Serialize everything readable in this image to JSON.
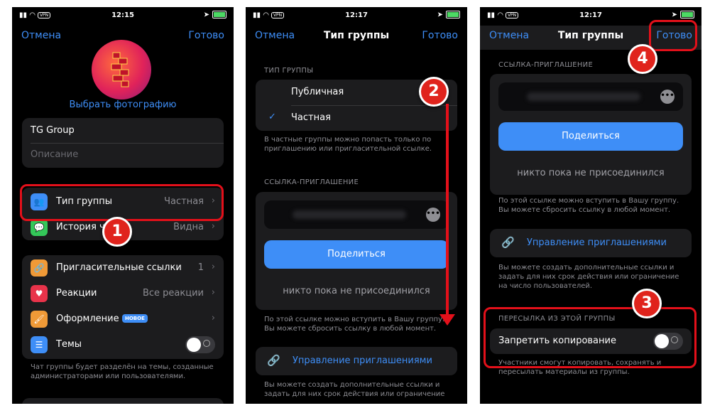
{
  "status": {
    "time1": "12:15",
    "time2": "12:17",
    "time3": "12:17",
    "vpn": "VPN"
  },
  "screen1": {
    "cancel": "Отмена",
    "done": "Готово",
    "choose_photo": "Выбрать фотографию",
    "group_name": "TG Group",
    "description_placeholder": "Описание",
    "group_type_label": "Тип группы",
    "group_type_value": "Частная",
    "history_label": "История ч",
    "history_value": "Видна",
    "invite_links_label": "Пригласительные ссылки",
    "invite_links_value": "1",
    "reactions_label": "Реакции",
    "reactions_value": "Все реакции",
    "appearance_label": "Оформление",
    "appearance_badge": "НОВОЕ",
    "topics_label": "Темы",
    "topics_caption": "Чат группы будет разделён на темы, созданные администраторами или пользователями.",
    "step_badge": "1"
  },
  "screen2": {
    "cancel": "Отмена",
    "title": "Тип группы",
    "done": "Готово",
    "type_section": "ТИП ГРУППЫ",
    "public": "Публичная",
    "private": "Частная",
    "check": "✓",
    "private_caption": "В частные группы можно попасть только по приглашению или пригласительной ссылке.",
    "link_section": "ССЫЛКА-ПРИГЛАШЕНИЕ",
    "share": "Поделиться",
    "nobody_joined": "никто пока не присоединился",
    "link_caption": "По этой ссылке можно вступить в Вашу группу. Вы можете сбросить ссылку в любой момент.",
    "manage_invites": "Управление приглашениями",
    "manage_caption": "Вы можете создать дополнительные ссылки и задать для них срок действия или ограничение",
    "step_badge": "2"
  },
  "screen3": {
    "cancel": "Отмена",
    "title": "Тип группы",
    "done": "Готово",
    "link_section": "ССЫЛКА-ПРИГЛАШЕНИЕ",
    "share": "Поделиться",
    "nobody_joined": "никто пока не присоединился",
    "link_caption": "По этой ссылке можно вступить в Вашу группу. Вы можете сбросить ссылку в любой момент.",
    "manage_invites": "Управление приглашениями",
    "manage_caption": "Вы можете создать дополнительные ссылки и задать для них срок действия или ограничение на число пользователей.",
    "forward_section": "ПЕРЕСЫЛКА ИЗ ЭТОЙ ГРУППЫ",
    "restrict_copy": "Запретить копирование",
    "restrict_caption": "Участники смогут копировать, сохранять и пересылать материалы из группы.",
    "step_badge_3": "3",
    "step_badge_4": "4"
  },
  "colors": {
    "accent": "#3e8ef7",
    "highlight": "#e3101a",
    "background": "#000000",
    "card": "#1c1c1e"
  }
}
